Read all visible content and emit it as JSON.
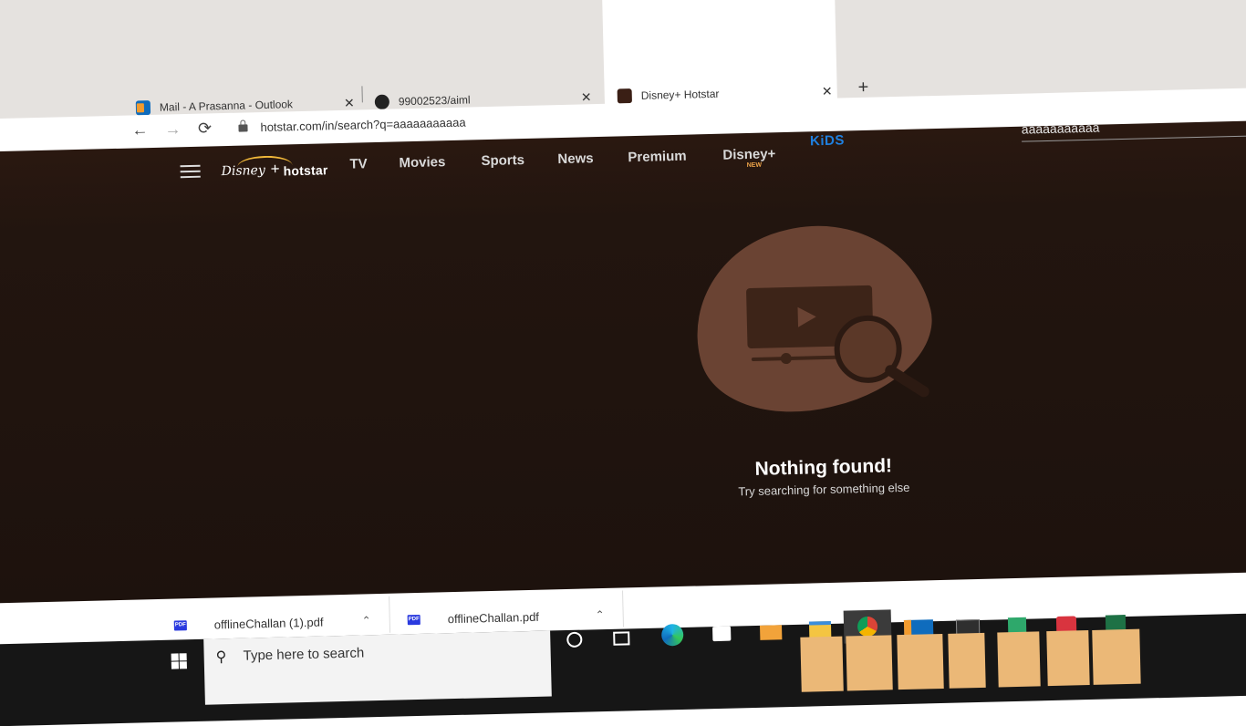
{
  "browser": {
    "tabs": [
      {
        "title": "Mail - A Prasanna - Outlook",
        "favicon": "outlook-icon",
        "active": false
      },
      {
        "title": "99002523/aiml",
        "favicon": "github-icon",
        "active": false
      },
      {
        "title": "Disney+ Hotstar",
        "favicon": "hotstar-icon",
        "active": true
      }
    ],
    "close_glyph": "✕",
    "new_tab_glyph": "+",
    "back_glyph": "←",
    "forward_glyph": "→",
    "reload_glyph": "⟳",
    "url": "hotstar.com/in/search?q=aaaaaaaaaaa"
  },
  "header": {
    "logo": {
      "disney": "Disney",
      "plus": "+",
      "hotstar": "hotstar"
    },
    "nav": [
      "TV",
      "Movies",
      "Sports",
      "News",
      "Premium",
      "Disney+"
    ],
    "new_badge": "NEW",
    "kids": "KiDS",
    "search_value": "aaaaaaaaaaa"
  },
  "empty_state": {
    "title": "Nothing found!",
    "subtitle": "Try searching for something else"
  },
  "downloads": [
    {
      "name": "offlineChallan (1).pdf",
      "icon": "PDF"
    },
    {
      "name": "offlineChallan.pdf",
      "icon": "PDF"
    }
  ],
  "downloads_chevron": "⌃",
  "taskbar": {
    "search_placeholder": "Type here to search",
    "search_glyph": "⚲"
  },
  "colors": {
    "page_bg": "#1d120d",
    "kids_blue": "#1f80e0",
    "new_orange": "#f0a64a",
    "logo_arc": "#f1b83a",
    "blob": "#6a4333"
  }
}
